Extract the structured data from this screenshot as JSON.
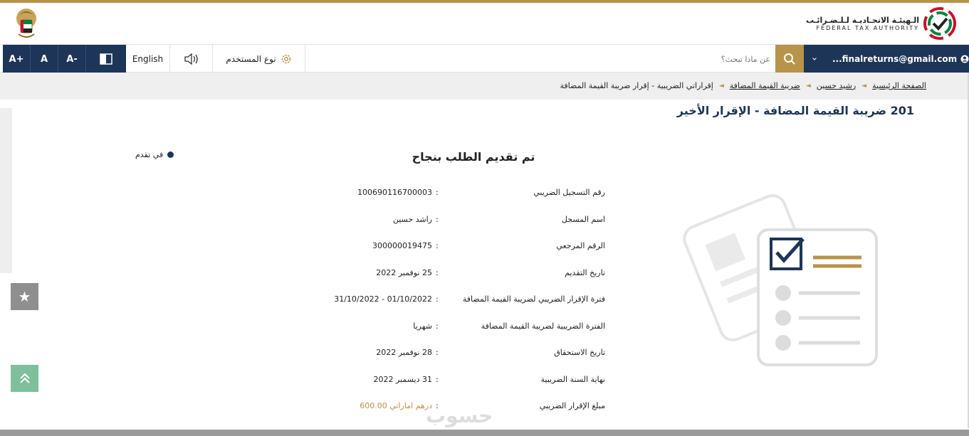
{
  "header": {
    "authority_ar": "الـهيئـة الاتحـاديـة لـلـضـرائـب",
    "authority_en": "FEDERAL TAX AUTHORITY"
  },
  "toolbar": {
    "font_increase": "A+",
    "font_normal": "A",
    "font_decrease": "A-",
    "language": "English",
    "user_type": "نوع المستخدم",
    "search_placeholder": "عن ماذا تبحث؟",
    "user_email": "...finalreturns@gmail.com"
  },
  "breadcrumb": {
    "items": [
      "الصفحة الرئيسية",
      "رشيد حسين",
      "ضريبة القيمة المضافة",
      "إقراراتي الضريبية - إقرار ضريبة القيمة المضافة"
    ]
  },
  "page": {
    "title": "201 ضريبة القيمة المضافة - الإقرار الأخير",
    "status": "في تقدم",
    "success_message": "تم تقديم الطلب بنجاح"
  },
  "details": [
    {
      "label": "رقم التسجيل الضريبي",
      "value": "100690116700003"
    },
    {
      "label": "اسم المسجل",
      "value": "راشد حسين"
    },
    {
      "label": "الرقم المرجعي",
      "value": "300000019475"
    },
    {
      "label": "تاريخ التقديم",
      "value": "25 نوفمبر 2022"
    },
    {
      "label": "فترة الإقرار الضريبي لضريبة القيمة المضافة",
      "value": "01/10/2022 - 31/10/2022"
    },
    {
      "label": "الفترة الضريبية لضريبة القيمة المضافة",
      "value": "شهريا"
    },
    {
      "label": "تاريخ الاستحقاق",
      "value": "28 نوفمبر 2022"
    },
    {
      "label": "نهاية السنة الضريبية",
      "value": "31 ديسمبر 2022"
    },
    {
      "label": "مبلغ الإقرار الضريبي",
      "value": "درهم اماراتي 600.00"
    }
  ],
  "watermark": "حسوب",
  "colors": {
    "navy": "#1d3557",
    "gold": "#b8934a",
    "green_button": "#7fbf9c"
  },
  "icons": [
    "uae-emblem-icon",
    "fta-logo-icon",
    "contrast-icon",
    "speaker-icon",
    "gear-icon",
    "search-icon",
    "chevron-down-icon",
    "user-avatar-icon",
    "star-icon",
    "double-chevron-up-icon",
    "checklist-illustration"
  ]
}
